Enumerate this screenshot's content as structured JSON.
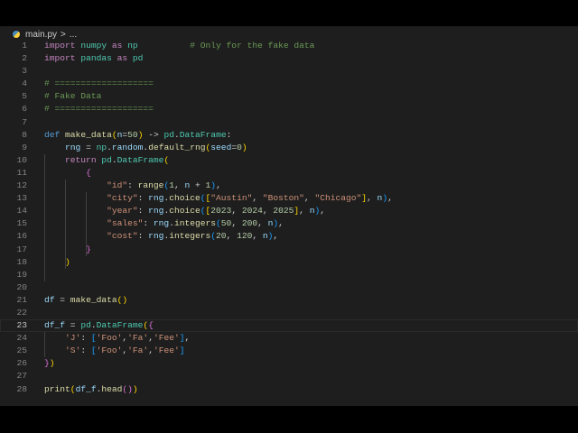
{
  "breadcrumb": {
    "file": "main.py",
    "separator": ">",
    "rest": "..."
  },
  "current_line": 23,
  "lines": [
    [
      [
        "import",
        "k"
      ],
      [
        " "
      ],
      [
        "numpy",
        "t"
      ],
      [
        " "
      ],
      [
        "as",
        "k"
      ],
      [
        " "
      ],
      [
        "np",
        "t"
      ],
      [
        "          "
      ],
      [
        "# Only for the fake data",
        "c"
      ]
    ],
    [
      [
        "import",
        "k"
      ],
      [
        " "
      ],
      [
        "pandas",
        "t"
      ],
      [
        " "
      ],
      [
        "as",
        "k"
      ],
      [
        " "
      ],
      [
        "pd",
        "t"
      ]
    ],
    [],
    [
      [
        "# ===================",
        "c"
      ]
    ],
    [
      [
        "# Fake Data",
        "c"
      ]
    ],
    [
      [
        "# ===================",
        "c"
      ]
    ],
    [],
    [
      [
        "def",
        "d"
      ],
      [
        " "
      ],
      [
        "make_data",
        "f"
      ],
      [
        "(",
        "b1"
      ],
      [
        "n",
        "v"
      ],
      [
        "="
      ],
      [
        "50",
        "n"
      ],
      [
        ")",
        "b1"
      ],
      [
        " -> "
      ],
      [
        "pd",
        "t"
      ],
      [
        "."
      ],
      [
        "DataFrame",
        "t"
      ],
      [
        ":"
      ]
    ],
    [
      [
        "    "
      ],
      [
        "rng",
        "v"
      ],
      [
        " = "
      ],
      [
        "np",
        "t"
      ],
      [
        "."
      ],
      [
        "random",
        "v"
      ],
      [
        "."
      ],
      [
        "default_rng",
        "f"
      ],
      [
        "(",
        "b1"
      ],
      [
        "seed",
        "v"
      ],
      [
        "="
      ],
      [
        "0",
        "n"
      ],
      [
        ")",
        "b1"
      ]
    ],
    [
      [
        "    "
      ],
      [
        "return",
        "k"
      ],
      [
        " "
      ],
      [
        "pd",
        "t"
      ],
      [
        "."
      ],
      [
        "DataFrame",
        "t"
      ],
      [
        "(",
        "b1"
      ]
    ],
    [
      [
        "        "
      ],
      [
        "{",
        "b2"
      ]
    ],
    [
      [
        "            "
      ],
      [
        "\"id\"",
        "s"
      ],
      [
        ": "
      ],
      [
        "range",
        "f"
      ],
      [
        "(",
        "b3"
      ],
      [
        "1",
        "n"
      ],
      [
        ", "
      ],
      [
        "n",
        "v"
      ],
      [
        " + "
      ],
      [
        "1",
        "n"
      ],
      [
        ")",
        "b3"
      ],
      [
        ","
      ]
    ],
    [
      [
        "            "
      ],
      [
        "\"city\"",
        "s"
      ],
      [
        ": "
      ],
      [
        "rng",
        "v"
      ],
      [
        "."
      ],
      [
        "choice",
        "f"
      ],
      [
        "(",
        "b3"
      ],
      [
        "[",
        "b1"
      ],
      [
        "\"Austin\"",
        "s"
      ],
      [
        ", "
      ],
      [
        "\"Boston\"",
        "s"
      ],
      [
        ", "
      ],
      [
        "\"Chicago\"",
        "s"
      ],
      [
        "]",
        "b1"
      ],
      [
        ", "
      ],
      [
        "n",
        "v"
      ],
      [
        ")",
        "b3"
      ],
      [
        ","
      ]
    ],
    [
      [
        "            "
      ],
      [
        "\"year\"",
        "s"
      ],
      [
        ": "
      ],
      [
        "rng",
        "v"
      ],
      [
        "."
      ],
      [
        "choice",
        "f"
      ],
      [
        "(",
        "b3"
      ],
      [
        "[",
        "b1"
      ],
      [
        "2023",
        "n"
      ],
      [
        ", "
      ],
      [
        "2024",
        "n"
      ],
      [
        ", "
      ],
      [
        "2025",
        "n"
      ],
      [
        "]",
        "b1"
      ],
      [
        ", "
      ],
      [
        "n",
        "v"
      ],
      [
        ")",
        "b3"
      ],
      [
        ","
      ]
    ],
    [
      [
        "            "
      ],
      [
        "\"sales\"",
        "s"
      ],
      [
        ": "
      ],
      [
        "rng",
        "v"
      ],
      [
        "."
      ],
      [
        "integers",
        "f"
      ],
      [
        "(",
        "b3"
      ],
      [
        "50",
        "n"
      ],
      [
        ", "
      ],
      [
        "200",
        "n"
      ],
      [
        ", "
      ],
      [
        "n",
        "v"
      ],
      [
        ")",
        "b3"
      ],
      [
        ","
      ]
    ],
    [
      [
        "            "
      ],
      [
        "\"cost\"",
        "s"
      ],
      [
        ": "
      ],
      [
        "rng",
        "v"
      ],
      [
        "."
      ],
      [
        "integers",
        "f"
      ],
      [
        "(",
        "b3"
      ],
      [
        "20",
        "n"
      ],
      [
        ", "
      ],
      [
        "120",
        "n"
      ],
      [
        ", "
      ],
      [
        "n",
        "v"
      ],
      [
        ")",
        "b3"
      ],
      [
        ","
      ]
    ],
    [
      [
        "        "
      ],
      [
        "}",
        "b2"
      ]
    ],
    [
      [
        "    "
      ],
      [
        ")",
        "b1"
      ]
    ],
    [],
    [],
    [
      [
        "df",
        "v"
      ],
      [
        " = "
      ],
      [
        "make_data",
        "f"
      ],
      [
        "(",
        "b1"
      ],
      [
        ")",
        "b1"
      ]
    ],
    [],
    [
      [
        "df_f",
        "v"
      ],
      [
        " = "
      ],
      [
        "pd",
        "t"
      ],
      [
        "."
      ],
      [
        "DataFrame",
        "t"
      ],
      [
        "(",
        "b1"
      ],
      [
        "{",
        "b2"
      ]
    ],
    [
      [
        "    "
      ],
      [
        "'J'",
        "s"
      ],
      [
        ": "
      ],
      [
        "[",
        "b3"
      ],
      [
        "'Foo'",
        "s"
      ],
      [
        ","
      ],
      [
        "'Fa'",
        "s"
      ],
      [
        ","
      ],
      [
        "'Fee'",
        "s"
      ],
      [
        "]",
        "b3"
      ],
      [
        ","
      ]
    ],
    [
      [
        "    "
      ],
      [
        "'S'",
        "s"
      ],
      [
        ": "
      ],
      [
        "[",
        "b3"
      ],
      [
        "'Foo'",
        "s"
      ],
      [
        ","
      ],
      [
        "'Fa'",
        "s"
      ],
      [
        ","
      ],
      [
        "'Fee'",
        "s"
      ],
      [
        "]",
        "b3"
      ]
    ],
    [
      [
        "}",
        "b2"
      ],
      [
        ")",
        "b1"
      ]
    ],
    [],
    [
      [
        "print",
        "f"
      ],
      [
        "(",
        "b1"
      ],
      [
        "df_f",
        "v"
      ],
      [
        "."
      ],
      [
        "head",
        "f"
      ],
      [
        "(",
        "b2"
      ],
      [
        ")",
        "b2"
      ],
      [
        ")",
        "b1"
      ]
    ]
  ]
}
